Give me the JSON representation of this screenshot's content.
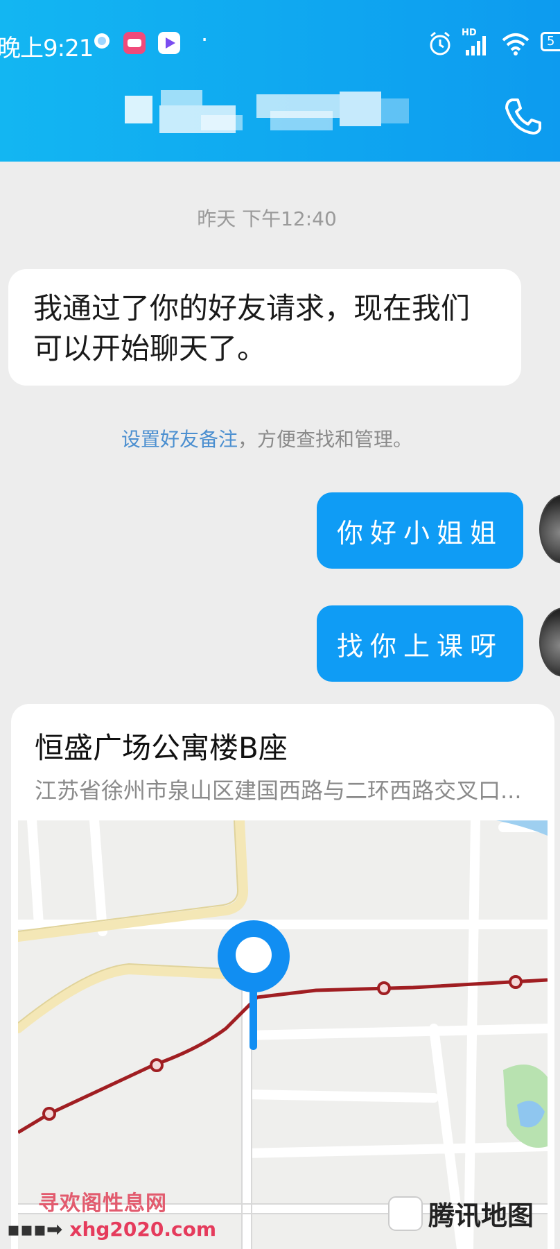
{
  "status_bar": {
    "time": "晚上9:21",
    "network_badge": "HD",
    "battery": "5"
  },
  "chat": {
    "timestamp": "昨天 下午12:40",
    "incoming_message": "我通过了你的好友请求，现在我们可以开始聊天了。",
    "system_note_link": "设置好友备注",
    "system_note_rest": "，方便查找和管理。",
    "outgoing_messages": [
      "你好小姐姐",
      "找你上课呀"
    ]
  },
  "location": {
    "title": "恒盛广场公寓楼B座",
    "address": "江苏省徐州市泉山区建国西路与二环西路交叉口...",
    "map_provider": "腾讯地图"
  },
  "watermark": {
    "line1": "寻欢阁性息网",
    "line2": "xhg2020.com"
  },
  "colors": {
    "header": "#0fa6f0",
    "outgoing_bubble": "#0f9cf5",
    "link": "#4b8fd0",
    "route": "#a01e22"
  }
}
